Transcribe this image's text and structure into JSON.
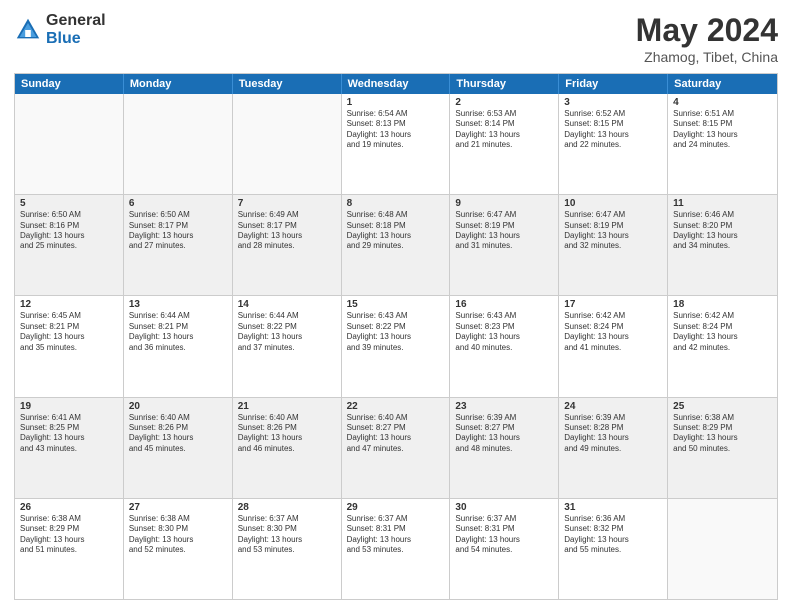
{
  "logo": {
    "general": "General",
    "blue": "Blue"
  },
  "title": "May 2024",
  "subtitle": "Zhamog, Tibet, China",
  "weekdays": [
    "Sunday",
    "Monday",
    "Tuesday",
    "Wednesday",
    "Thursday",
    "Friday",
    "Saturday"
  ],
  "rows": [
    [
      {
        "day": "",
        "info": ""
      },
      {
        "day": "",
        "info": ""
      },
      {
        "day": "",
        "info": ""
      },
      {
        "day": "1",
        "info": "Sunrise: 6:54 AM\nSunset: 8:13 PM\nDaylight: 13 hours\nand 19 minutes."
      },
      {
        "day": "2",
        "info": "Sunrise: 6:53 AM\nSunset: 8:14 PM\nDaylight: 13 hours\nand 21 minutes."
      },
      {
        "day": "3",
        "info": "Sunrise: 6:52 AM\nSunset: 8:15 PM\nDaylight: 13 hours\nand 22 minutes."
      },
      {
        "day": "4",
        "info": "Sunrise: 6:51 AM\nSunset: 8:15 PM\nDaylight: 13 hours\nand 24 minutes."
      }
    ],
    [
      {
        "day": "5",
        "info": "Sunrise: 6:50 AM\nSunset: 8:16 PM\nDaylight: 13 hours\nand 25 minutes."
      },
      {
        "day": "6",
        "info": "Sunrise: 6:50 AM\nSunset: 8:17 PM\nDaylight: 13 hours\nand 27 minutes."
      },
      {
        "day": "7",
        "info": "Sunrise: 6:49 AM\nSunset: 8:17 PM\nDaylight: 13 hours\nand 28 minutes."
      },
      {
        "day": "8",
        "info": "Sunrise: 6:48 AM\nSunset: 8:18 PM\nDaylight: 13 hours\nand 29 minutes."
      },
      {
        "day": "9",
        "info": "Sunrise: 6:47 AM\nSunset: 8:19 PM\nDaylight: 13 hours\nand 31 minutes."
      },
      {
        "day": "10",
        "info": "Sunrise: 6:47 AM\nSunset: 8:19 PM\nDaylight: 13 hours\nand 32 minutes."
      },
      {
        "day": "11",
        "info": "Sunrise: 6:46 AM\nSunset: 8:20 PM\nDaylight: 13 hours\nand 34 minutes."
      }
    ],
    [
      {
        "day": "12",
        "info": "Sunrise: 6:45 AM\nSunset: 8:21 PM\nDaylight: 13 hours\nand 35 minutes."
      },
      {
        "day": "13",
        "info": "Sunrise: 6:44 AM\nSunset: 8:21 PM\nDaylight: 13 hours\nand 36 minutes."
      },
      {
        "day": "14",
        "info": "Sunrise: 6:44 AM\nSunset: 8:22 PM\nDaylight: 13 hours\nand 37 minutes."
      },
      {
        "day": "15",
        "info": "Sunrise: 6:43 AM\nSunset: 8:22 PM\nDaylight: 13 hours\nand 39 minutes."
      },
      {
        "day": "16",
        "info": "Sunrise: 6:43 AM\nSunset: 8:23 PM\nDaylight: 13 hours\nand 40 minutes."
      },
      {
        "day": "17",
        "info": "Sunrise: 6:42 AM\nSunset: 8:24 PM\nDaylight: 13 hours\nand 41 minutes."
      },
      {
        "day": "18",
        "info": "Sunrise: 6:42 AM\nSunset: 8:24 PM\nDaylight: 13 hours\nand 42 minutes."
      }
    ],
    [
      {
        "day": "19",
        "info": "Sunrise: 6:41 AM\nSunset: 8:25 PM\nDaylight: 13 hours\nand 43 minutes."
      },
      {
        "day": "20",
        "info": "Sunrise: 6:40 AM\nSunset: 8:26 PM\nDaylight: 13 hours\nand 45 minutes."
      },
      {
        "day": "21",
        "info": "Sunrise: 6:40 AM\nSunset: 8:26 PM\nDaylight: 13 hours\nand 46 minutes."
      },
      {
        "day": "22",
        "info": "Sunrise: 6:40 AM\nSunset: 8:27 PM\nDaylight: 13 hours\nand 47 minutes."
      },
      {
        "day": "23",
        "info": "Sunrise: 6:39 AM\nSunset: 8:27 PM\nDaylight: 13 hours\nand 48 minutes."
      },
      {
        "day": "24",
        "info": "Sunrise: 6:39 AM\nSunset: 8:28 PM\nDaylight: 13 hours\nand 49 minutes."
      },
      {
        "day": "25",
        "info": "Sunrise: 6:38 AM\nSunset: 8:29 PM\nDaylight: 13 hours\nand 50 minutes."
      }
    ],
    [
      {
        "day": "26",
        "info": "Sunrise: 6:38 AM\nSunset: 8:29 PM\nDaylight: 13 hours\nand 51 minutes."
      },
      {
        "day": "27",
        "info": "Sunrise: 6:38 AM\nSunset: 8:30 PM\nDaylight: 13 hours\nand 52 minutes."
      },
      {
        "day": "28",
        "info": "Sunrise: 6:37 AM\nSunset: 8:30 PM\nDaylight: 13 hours\nand 53 minutes."
      },
      {
        "day": "29",
        "info": "Sunrise: 6:37 AM\nSunset: 8:31 PM\nDaylight: 13 hours\nand 53 minutes."
      },
      {
        "day": "30",
        "info": "Sunrise: 6:37 AM\nSunset: 8:31 PM\nDaylight: 13 hours\nand 54 minutes."
      },
      {
        "day": "31",
        "info": "Sunrise: 6:36 AM\nSunset: 8:32 PM\nDaylight: 13 hours\nand 55 minutes."
      },
      {
        "day": "",
        "info": ""
      }
    ]
  ]
}
